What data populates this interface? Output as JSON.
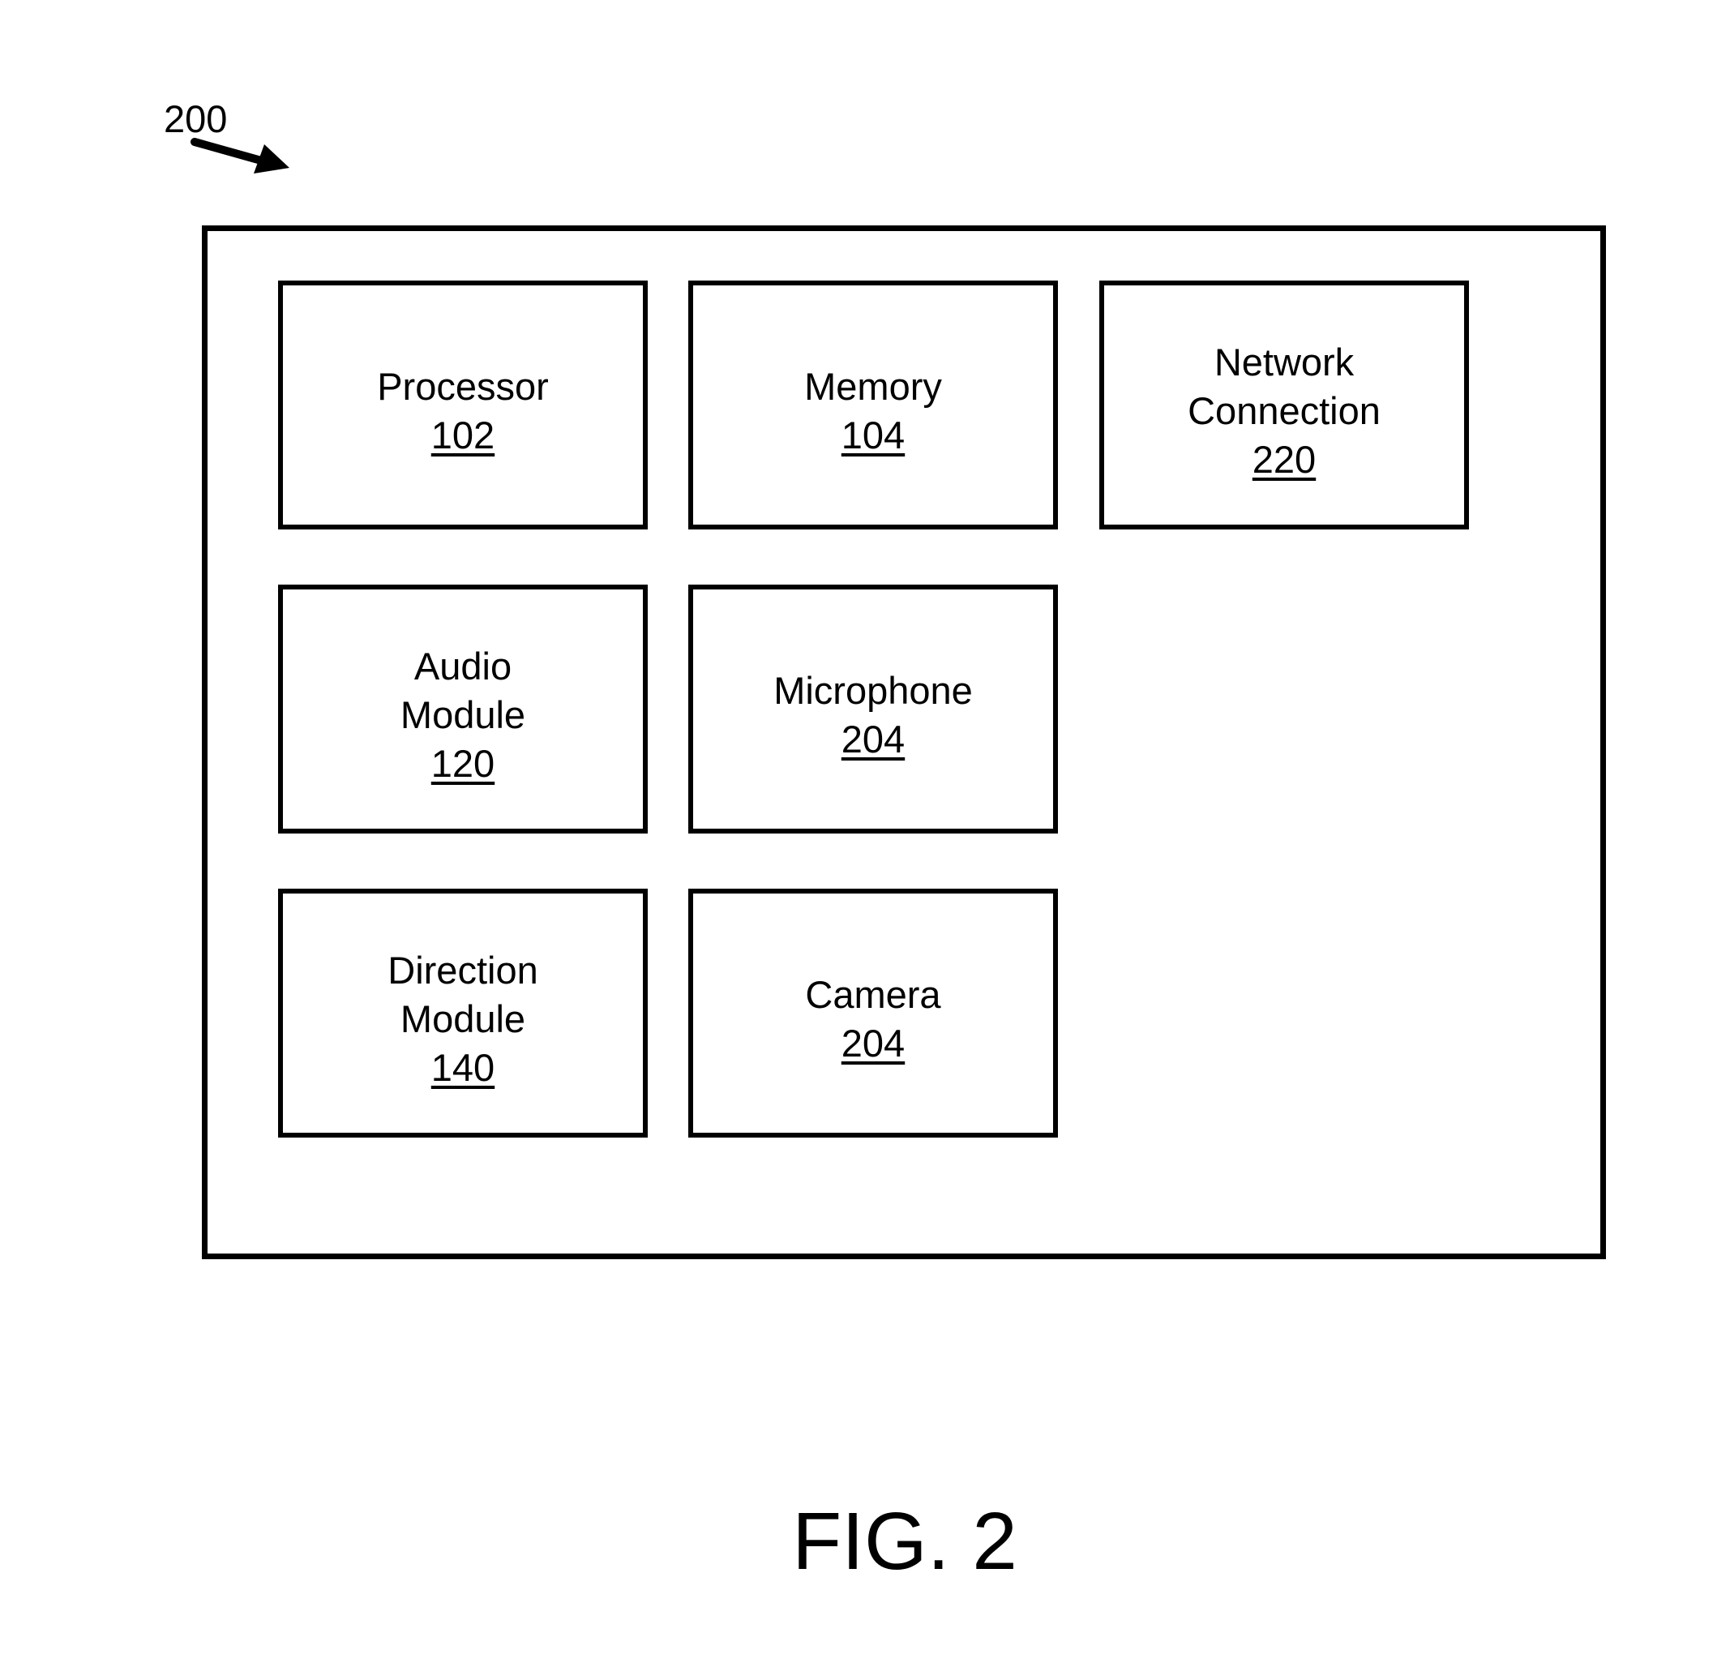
{
  "figure": {
    "reference_numeral": "200",
    "caption": "FIG. 2"
  },
  "components": [
    {
      "lines": [
        "Processor"
      ],
      "number": "102"
    },
    {
      "lines": [
        "Memory"
      ],
      "number": "104"
    },
    {
      "lines": [
        "Network",
        "Connection"
      ],
      "number": "220"
    },
    {
      "lines": [
        "Audio",
        "Module"
      ],
      "number": "120"
    },
    {
      "lines": [
        "Microphone"
      ],
      "number": "204"
    },
    {
      "lines": [
        "Direction",
        "Module"
      ],
      "number": "140"
    },
    {
      "lines": [
        "Camera"
      ],
      "number": "204"
    }
  ]
}
